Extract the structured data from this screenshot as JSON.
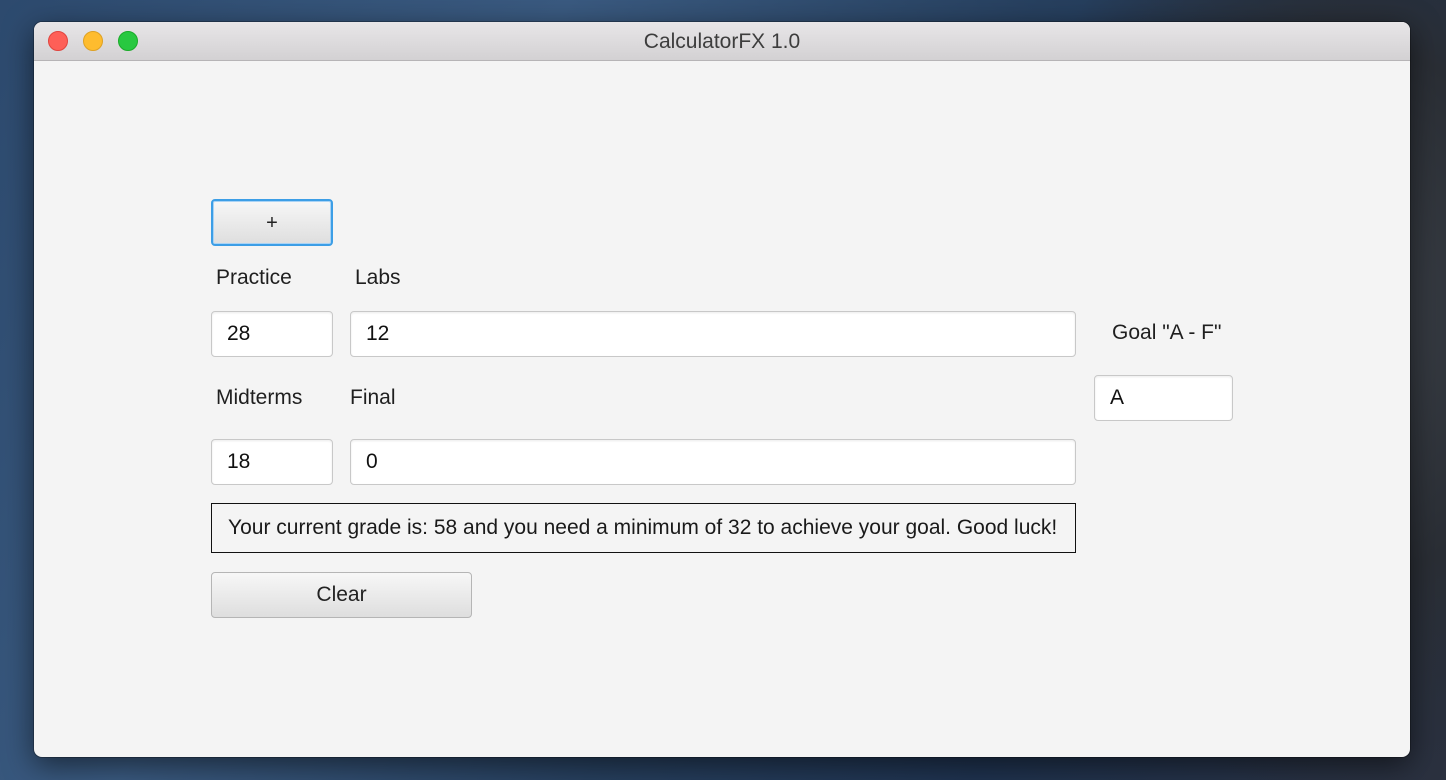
{
  "window": {
    "title": "CalculatorFX 1.0"
  },
  "buttons": {
    "add_label": "+",
    "clear_label": "Clear"
  },
  "labels": {
    "practice": "Practice",
    "labs": "Labs",
    "midterms": "Midterms",
    "final": "Final",
    "goal": "Goal  \"A - F\""
  },
  "fields": {
    "practice_value": "28",
    "labs_value": "12",
    "midterms_value": "18",
    "final_value": "0",
    "goal_value": "A"
  },
  "result": {
    "message": "Your current grade is: 58  and you need a minimum of 32 to achieve your goal. Good luck!"
  },
  "colors": {
    "focus_border": "#3c9ee6",
    "close": "#fe5f57",
    "minimize": "#febc2e",
    "maximize": "#28c840"
  }
}
